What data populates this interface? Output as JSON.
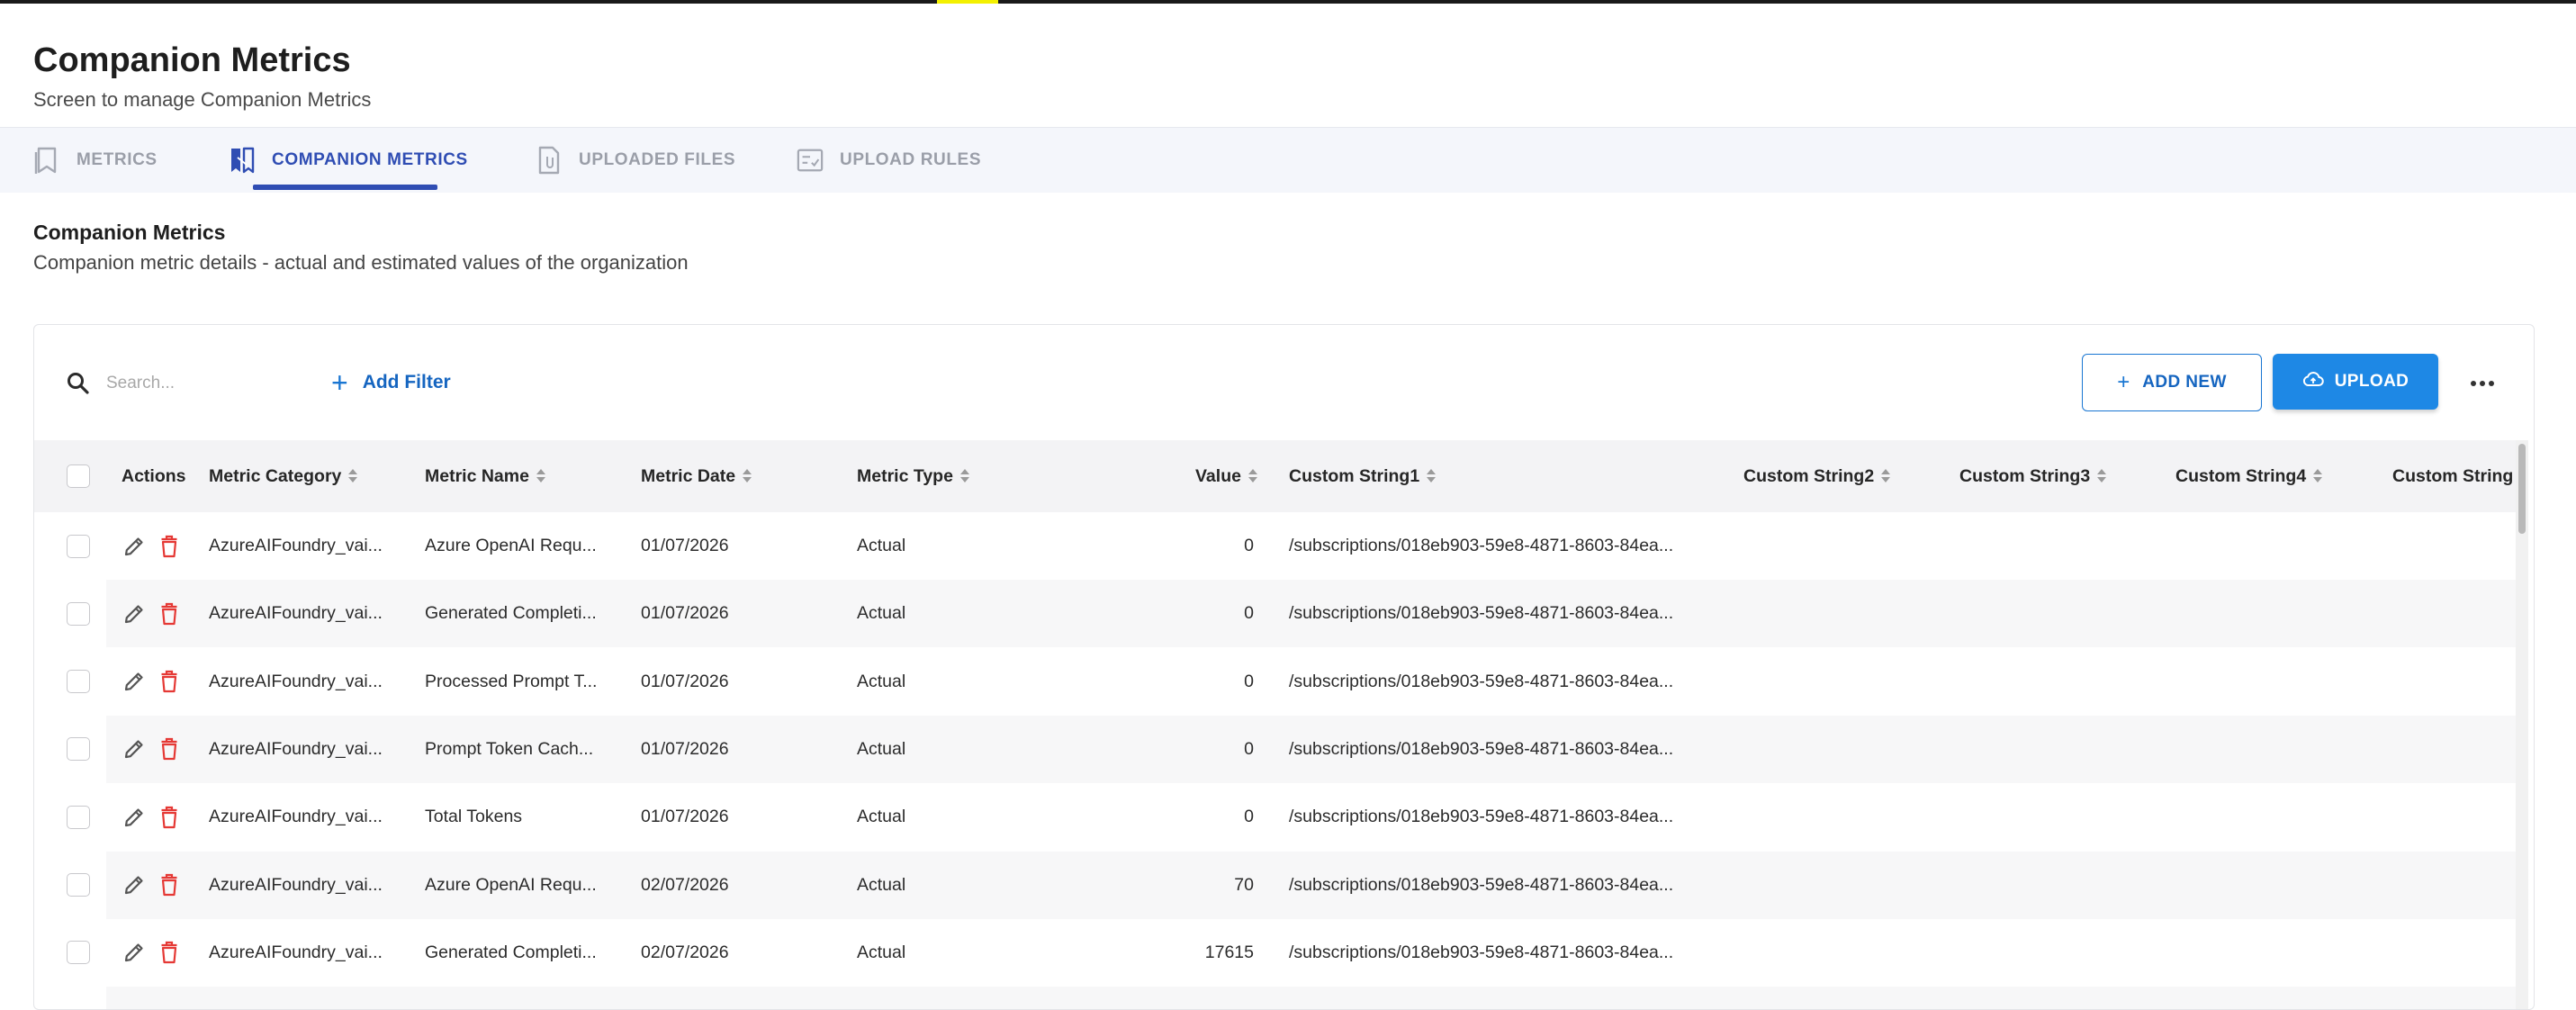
{
  "page": {
    "title": "Companion Metrics",
    "subtitle": "Screen to manage Companion Metrics"
  },
  "tabs": [
    {
      "label": "METRICS",
      "icon": "bookmark-icon",
      "active": false
    },
    {
      "label": "COMPANION METRICS",
      "icon": "companion-metrics-icon",
      "active": true
    },
    {
      "label": "UPLOADED FILES",
      "icon": "file-icon",
      "active": false
    },
    {
      "label": "UPLOAD RULES",
      "icon": "rules-icon",
      "active": false
    }
  ],
  "section": {
    "title": "Companion Metrics",
    "description": "Companion metric details - actual and estimated values of the organization"
  },
  "toolbar": {
    "search_placeholder": "Search...",
    "add_filter_label": "Add Filter",
    "add_new_label": "ADD NEW",
    "upload_label": "UPLOAD",
    "accent_color": "#1e88e5"
  },
  "table": {
    "columns": [
      "Actions",
      "Metric Category",
      "Metric Name",
      "Metric Date",
      "Metric Type",
      "Value",
      "Custom String1",
      "Custom String2",
      "Custom String3",
      "Custom String4",
      "Custom String"
    ],
    "rows": [
      {
        "category": "AzureAIFoundry_vai...",
        "name": "Azure OpenAI Requ...",
        "date": "01/07/2026",
        "type": "Actual",
        "value": "0",
        "cs1": "/subscriptions/018eb903-59e8-4871-8603-84ea..."
      },
      {
        "category": "AzureAIFoundry_vai...",
        "name": "Generated Completi...",
        "date": "01/07/2026",
        "type": "Actual",
        "value": "0",
        "cs1": "/subscriptions/018eb903-59e8-4871-8603-84ea..."
      },
      {
        "category": "AzureAIFoundry_vai...",
        "name": "Processed Prompt T...",
        "date": "01/07/2026",
        "type": "Actual",
        "value": "0",
        "cs1": "/subscriptions/018eb903-59e8-4871-8603-84ea..."
      },
      {
        "category": "AzureAIFoundry_vai...",
        "name": "Prompt Token Cach...",
        "date": "01/07/2026",
        "type": "Actual",
        "value": "0",
        "cs1": "/subscriptions/018eb903-59e8-4871-8603-84ea..."
      },
      {
        "category": "AzureAIFoundry_vai...",
        "name": "Total Tokens",
        "date": "01/07/2026",
        "type": "Actual",
        "value": "0",
        "cs1": "/subscriptions/018eb903-59e8-4871-8603-84ea..."
      },
      {
        "category": "AzureAIFoundry_vai...",
        "name": "Azure OpenAI Requ...",
        "date": "02/07/2026",
        "type": "Actual",
        "value": "70",
        "cs1": "/subscriptions/018eb903-59e8-4871-8603-84ea..."
      },
      {
        "category": "AzureAIFoundry_vai...",
        "name": "Generated Completi...",
        "date": "02/07/2026",
        "type": "Actual",
        "value": "17615",
        "cs1": "/subscriptions/018eb903-59e8-4871-8603-84ea..."
      },
      {
        "category": "",
        "name": "",
        "date": "",
        "type": "",
        "value": "",
        "cs1": ""
      }
    ]
  }
}
